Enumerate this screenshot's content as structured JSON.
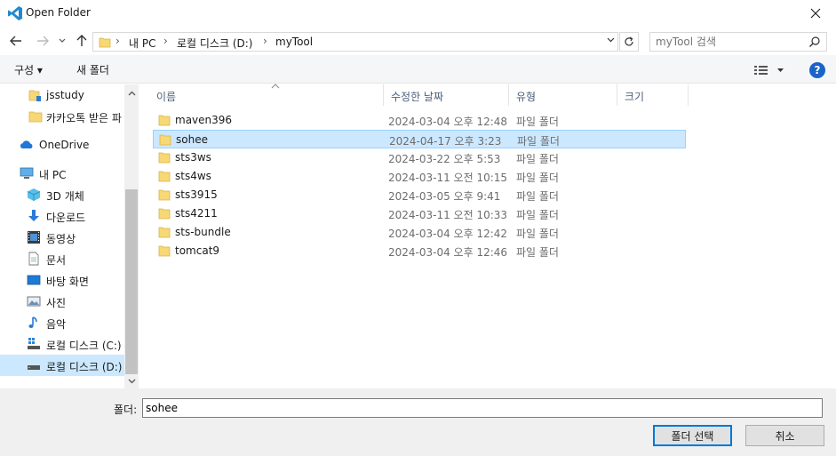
{
  "window": {
    "title": "Open Folder"
  },
  "address": {
    "crumbs": [
      "내 PC",
      "로컬 디스크 (D:)",
      "myTool"
    ]
  },
  "search": {
    "placeholder": "myTool 검색"
  },
  "toolbar": {
    "organize_label": "구성 ▾",
    "new_folder_label": "새 폴더",
    "help_label": "?"
  },
  "sidebar": {
    "items": [
      {
        "label": "jsstudy",
        "icon": "folder-pin-icon"
      },
      {
        "label": "카카오톡 받은 파",
        "icon": "folder-icon"
      },
      {
        "label": "OneDrive",
        "icon": "cloud-icon"
      },
      {
        "label": "내 PC",
        "icon": "computer-icon"
      },
      {
        "label": "3D 개체",
        "icon": "cube-icon"
      },
      {
        "label": "다운로드",
        "icon": "download-icon"
      },
      {
        "label": "동영상",
        "icon": "video-icon"
      },
      {
        "label": "문서",
        "icon": "document-icon"
      },
      {
        "label": "바탕 화면",
        "icon": "desktop-icon"
      },
      {
        "label": "사진",
        "icon": "picture-icon"
      },
      {
        "label": "음악",
        "icon": "music-icon"
      },
      {
        "label": "로컬 디스크 (C:)",
        "icon": "drive-icon"
      },
      {
        "label": "로컬 디스크 (D:)",
        "icon": "drive-icon"
      }
    ]
  },
  "columns": {
    "name": "이름",
    "date": "수정한 날짜",
    "type": "유형",
    "size": "크기"
  },
  "files": [
    {
      "name": "maven396",
      "date": "2024-03-04 오후 12:48",
      "type": "파일 폴더"
    },
    {
      "name": "sohee",
      "date": "2024-04-17 오후 3:23",
      "type": "파일 폴더"
    },
    {
      "name": "sts3ws",
      "date": "2024-03-22 오후 5:53",
      "type": "파일 폴더"
    },
    {
      "name": "sts4ws",
      "date": "2024-03-11 오전 10:15",
      "type": "파일 폴더"
    },
    {
      "name": "sts3915",
      "date": "2024-03-05 오후 9:41",
      "type": "파일 폴더"
    },
    {
      "name": "sts4211",
      "date": "2024-03-11 오전 10:33",
      "type": "파일 폴더"
    },
    {
      "name": "sts-bundle",
      "date": "2024-03-04 오후 12:42",
      "type": "파일 폴더"
    },
    {
      "name": "tomcat9",
      "date": "2024-03-04 오후 12:46",
      "type": "파일 폴더"
    }
  ],
  "footer": {
    "folder_label": "폴더:",
    "folder_value": "sohee",
    "select_label": "폴더 선택",
    "cancel_label": "취소"
  },
  "colors": {
    "accent": "#0078d7",
    "selection": "#cce8ff",
    "folder": "#f8d775"
  }
}
